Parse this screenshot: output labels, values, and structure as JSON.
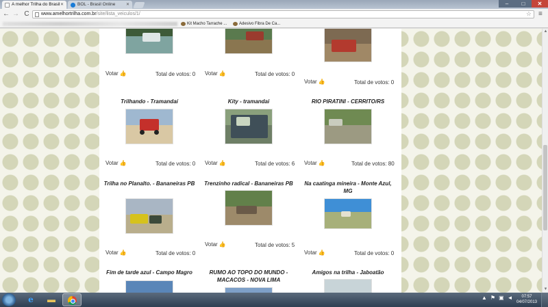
{
  "browser": {
    "tabs": [
      {
        "title": "A melhor Trilha do Brasil",
        "active": true
      },
      {
        "title": "BOL - Brasil Online",
        "active": false
      }
    ],
    "window_controls": {
      "minimize": "–",
      "maximize": "□",
      "close": "✕"
    },
    "address": {
      "host": "www.amelhortrilha.com.br",
      "path": "/site/lista_veiculos/1/"
    },
    "bookmarks": [
      {
        "label": "Kit Macho Tarrache ..."
      },
      {
        "label": "Adesivo Fibra De Ca..."
      }
    ]
  },
  "vote_label": "Votar",
  "cards": [
    {
      "title": "",
      "votes_text": "Total de votos: 0"
    },
    {
      "title": "",
      "votes_text": "Total de votos: 0"
    },
    {
      "title": "",
      "votes_text": "Total de votos: 0"
    },
    {
      "title": "Trilhando - Tramandaí",
      "votes_text": "Total de votos: 0"
    },
    {
      "title": "Kity - tramandai",
      "votes_text": "Total de votos: 6"
    },
    {
      "title": "RIO PIRATINI - CERRITO/RS",
      "votes_text": "Total de votos: 80"
    },
    {
      "title": "Trilha no Planalto. - Bananeiras PB",
      "votes_text": "Total de votos: 0"
    },
    {
      "title": "Trenzinho radical - Bananeiras PB",
      "votes_text": "Total de votos: 5"
    },
    {
      "title": "Na caatinga mineira - Monte Azul, MG",
      "votes_text": "Total de votos: 0"
    },
    {
      "title": "Fim de tarde azul - Campo Magro",
      "votes_text": ""
    },
    {
      "title": "RUMO AO TOPO DO MUNDO - MACACOS - NOVA LIMA",
      "votes_text": ""
    },
    {
      "title": "Amigos na trilha - Jaboatão",
      "votes_text": ""
    }
  ],
  "taskbar": {
    "clock_time": "07:57",
    "clock_date": "04/07/2013"
  },
  "icons": {
    "thumbs_up": "👍",
    "back": "←",
    "forward": "→",
    "reload": "C",
    "star": "☆",
    "wrench": "≡"
  }
}
